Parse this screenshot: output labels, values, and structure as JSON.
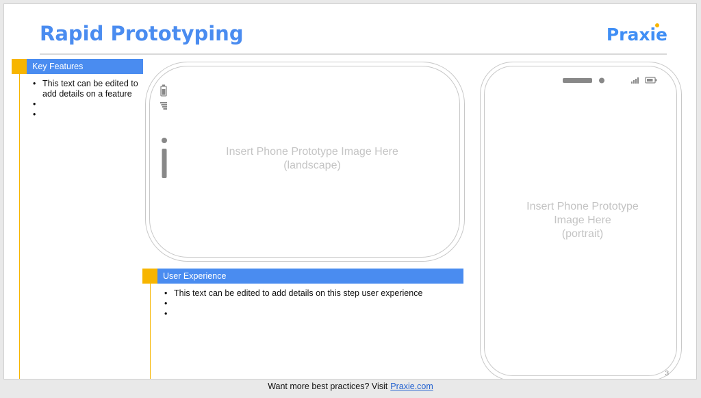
{
  "slide": {
    "title": "Rapid Prototyping",
    "logo": "Praxie",
    "page_number": "3"
  },
  "key_features": {
    "header": "Key Features",
    "bullets": [
      "This text can be edited to add details on a feature",
      "",
      ""
    ]
  },
  "user_experience": {
    "header": "User Experience",
    "bullets": [
      "This text can be edited to add details on this step user experience",
      "",
      ""
    ]
  },
  "landscape_phone": {
    "placeholder_line1": "Insert Phone Prototype Image Here",
    "placeholder_line2": "(landscape)"
  },
  "portrait_phone": {
    "placeholder_line1": "Insert Phone Prototype",
    "placeholder_line2": "Image Here",
    "placeholder_line3": "(portrait)"
  },
  "footer": {
    "text": "Want more best practices? Visit",
    "link": "Praxie.com"
  },
  "colors": {
    "title_blue": "#4a8cf0",
    "accent_orange": "#f7b500",
    "placeholder_gray": "#c4c4c4"
  }
}
